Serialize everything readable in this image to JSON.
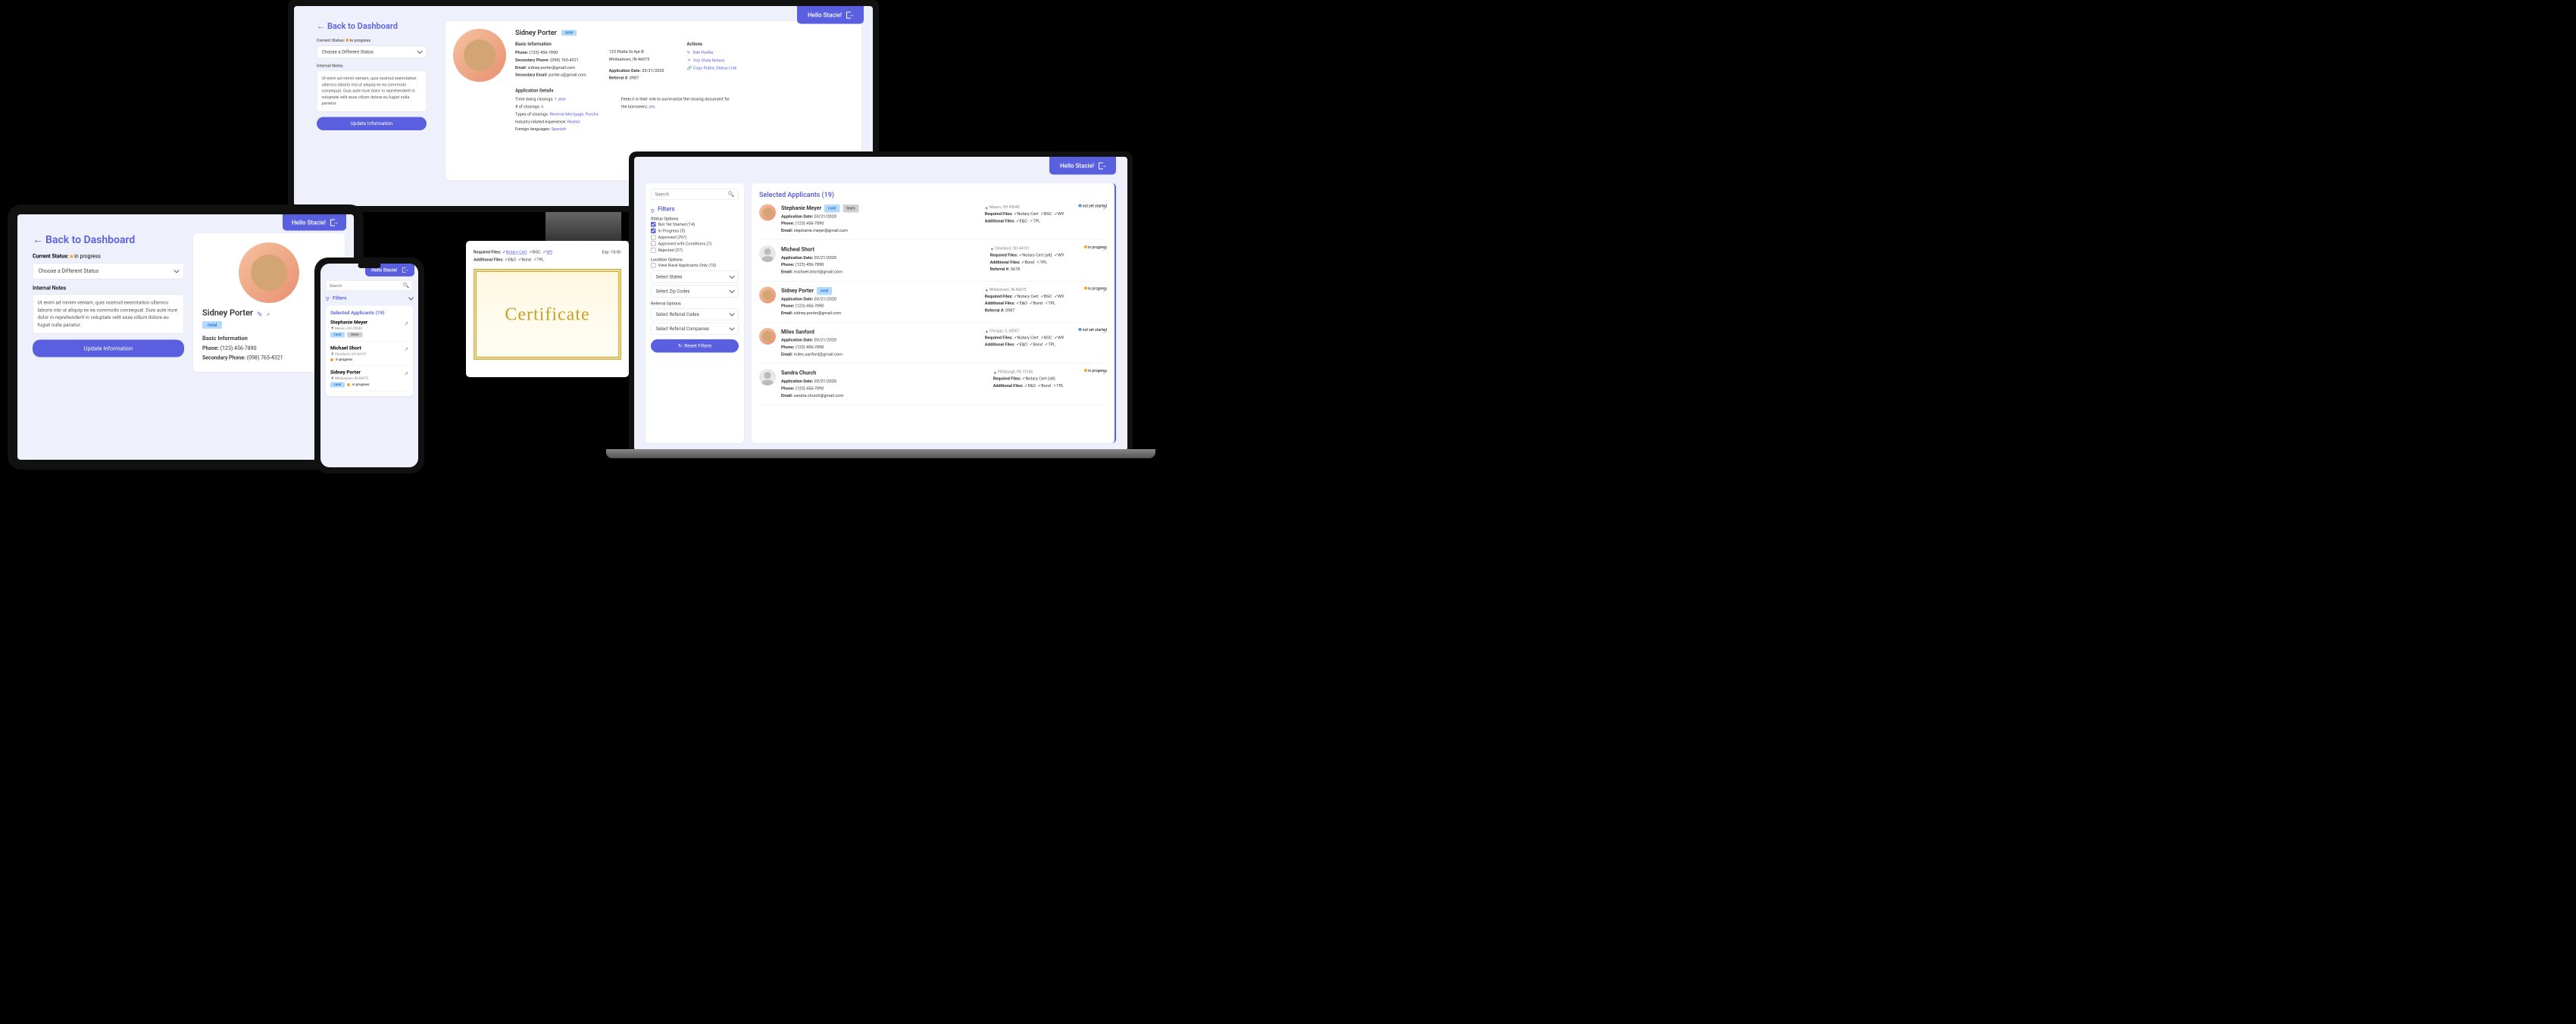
{
  "greeting": "Hello Stacie!",
  "back_link": "Back to Dashboard",
  "status": {
    "label": "Current Status:",
    "value": "in progress",
    "select_placeholder": "Choose a Different Status"
  },
  "notes": {
    "label": "Internal Notes",
    "text": "Ut enim ad minim veniam, quis nostrud exercitation ullamco laboris nisi ut aliquip ex ea commodo consequat. Duis aute irure dolor in reprehenderit in voluptate velit esse cillum dolore eu fugiat nulla pariatur."
  },
  "update_btn": "Update Information",
  "profile": {
    "name": "Sidney Porter",
    "tag": "rural",
    "basic_header": "Basic  Information",
    "phone_label": "Phone:",
    "phone": "(123) 456-7890",
    "secondary_phone_label": "Secondary Phone:",
    "secondary_phone": "(098) 765-4321",
    "email_label": "Email:",
    "email": "sidney.porter@gmail.com",
    "secondary_email_label": "Secondary Email:",
    "secondary_email": "porter.s@gmail.com",
    "address_line1": "123 Platte St Apt B",
    "address_line2": "Whitestown, IN 46075",
    "app_details_header": "Application Details",
    "app_date_label": "Application Date:",
    "app_date": "03/21/2020",
    "referral_label": "Referral #:",
    "referral": "0987",
    "time_closings_label": "Time doing closings:",
    "time_closings": "1 year",
    "num_closings_label": "# of closings:",
    "num_closings": "6",
    "types_closings_label": "Types of closings:",
    "types_closings": "Reverse Mortgage, Purcha",
    "industry_exp_label": "Industry related experience:",
    "industry_exp": "Realtor",
    "languages_label": "Foreign languages:",
    "languages": "Spanish",
    "summarize_label": "Feels it is their role to summarize the closing document for the borrowers:",
    "summarize": "yes",
    "actions_header": "Actions",
    "action_edit": "Edit Profile",
    "action_visit": "Vist State Notary",
    "action_copy": "Copy Public Status Link"
  },
  "files": {
    "required_label": "Required Files:",
    "required": [
      {
        "name": "Notary Cert",
        "ok": true,
        "link": true
      },
      {
        "name": "BGC",
        "ok": true
      },
      {
        "name": "W9",
        "ok": true,
        "link": true
      }
    ],
    "additional_label": "Additional Files:",
    "additional": [
      {
        "name": "E&O",
        "ok": true
      },
      {
        "name": "Bond",
        "ok": true
      },
      {
        "name": "TPL",
        "ok": false
      }
    ],
    "exp_label": "Exp: 10/8/",
    "cert_word": "Certificate"
  },
  "search_placeholder": "Search",
  "filters": {
    "header": "Filters",
    "status_options_label": "Status Options",
    "status_options": [
      {
        "label": "Not Yet Started (14)",
        "checked": true
      },
      {
        "label": "In Progress (5)",
        "checked": true
      },
      {
        "label": "Approved (297)",
        "checked": false
      },
      {
        "label": "Approved with Conditions (7)",
        "checked": false
      },
      {
        "label": "Rejected (57)",
        "checked": false
      }
    ],
    "location_label": "Location Options",
    "rural_only": {
      "label": "View Rural Applicants Only (18)",
      "checked": false
    },
    "select_states": "Select States",
    "select_zip": "Select Zip Codes",
    "referral_label": "Referral Options",
    "select_codes": "Select Referral Codes",
    "select_companies": "Select Referral Companies",
    "reset_btn": "Reset Filters"
  },
  "applicants": {
    "header": "Selected Applicants (19)",
    "required_files_label": "Required Files:",
    "additional_files_label": "Additional Files:",
    "app_date_label": "Application Date:",
    "phone_label": "Phone:",
    "email_label": "Email:",
    "referral_label": "Referral #:",
    "rows": [
      {
        "name": "Stephanie Meyer",
        "tags": [
          "rural",
          "team"
        ],
        "location": "Mason, OH 45040",
        "status": "not yet started",
        "app_date": "03/21/2020",
        "phone": "(123) 456-7890",
        "email": "stephanie.meyer@gmail.com",
        "required": [
          {
            "n": "Notary Cert",
            "ok": true
          },
          {
            "n": "BGC",
            "ok": true
          },
          {
            "n": "W9",
            "ok": true
          }
        ],
        "additional": [
          {
            "n": "E&O",
            "ok": true
          },
          {
            "n": "TPL",
            "ok": false
          }
        ]
      },
      {
        "name": "Micheal Short",
        "placeholder": true,
        "location": "Cleveland, OH 44101",
        "status": "in progress",
        "app_date": "03/21/2020",
        "phone": "(123) 456-7890",
        "email": "michael.short@gmail.com",
        "referral": "5678",
        "required": [
          {
            "n": "Notary Cert (alt)",
            "ok": true
          },
          {
            "n": "W9",
            "ok": true
          }
        ],
        "additional": [
          {
            "n": "Bond",
            "ok": true
          },
          {
            "n": "TPL",
            "ok": false
          }
        ]
      },
      {
        "name": "Sidney Porter",
        "tags": [
          "rural"
        ],
        "location": "Whitestown, IN 46075",
        "status": "in progress",
        "app_date": "03/21/2020",
        "phone": "(123) 456-7890",
        "email": "sidney.porter@gmail.com",
        "referral": "0987",
        "required": [
          {
            "n": "Notary Cert",
            "ok": true
          },
          {
            "n": "BGC",
            "ok": true
          },
          {
            "n": "W9",
            "ok": true
          }
        ],
        "additional": [
          {
            "n": "E&O",
            "ok": true
          },
          {
            "n": "Bond",
            "ok": true
          },
          {
            "n": "TPL",
            "ok": false
          }
        ]
      },
      {
        "name": "Miles Sanford",
        "location": "Chicago, IL 60007",
        "status": "not yet started",
        "app_date": "03/21/2020",
        "phone": "(123) 456-7890",
        "email": "miles.sanford@gmail.com",
        "required": [
          {
            "n": "Notary Cert",
            "ok": true
          },
          {
            "n": "BGC",
            "ok": true
          },
          {
            "n": "W9",
            "ok": true
          }
        ],
        "additional": [
          {
            "n": "E&O",
            "ok": true
          },
          {
            "n": "Bond",
            "ok": true
          },
          {
            "n": "TPL",
            "ok": true
          }
        ]
      },
      {
        "name": "Sandra Church",
        "placeholder": true,
        "location": "Pittsburgh, PA 15106",
        "status": "in progress",
        "app_date": "03/21/2020",
        "phone": "(123) 456-7890",
        "email": "sandra.church@gmail.com",
        "required": [
          {
            "n": "Notary Cert (alt)",
            "ok": true
          }
        ],
        "additional": [
          {
            "n": "E&O",
            "ok": true
          },
          {
            "n": "Bond",
            "ok": true
          },
          {
            "n": "TPL",
            "ok": false
          }
        ]
      }
    ]
  },
  "mobile": {
    "applicants_header": "Selected Applicants (19)",
    "rows": [
      {
        "name": "Stephanie Meyer",
        "tags": [
          "rural",
          "team"
        ],
        "location": "Mason, OH 45040"
      },
      {
        "name": "Michael Short",
        "location": "Cleveland, OH 44101",
        "status": "in progress"
      },
      {
        "name": "Sidney Porter",
        "tags": [
          "rural"
        ],
        "location": "Whitestown, IN 46075",
        "status": "in progress"
      }
    ]
  }
}
